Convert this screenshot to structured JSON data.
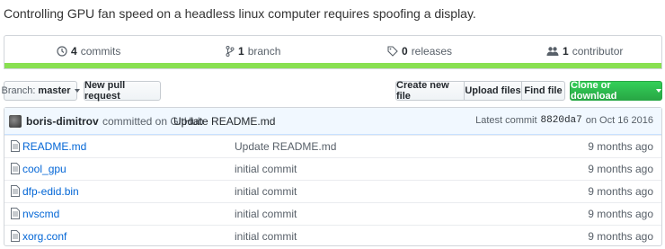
{
  "repo": {
    "description": "Controlling GPU fan speed on a headless linux computer requires spoofing a display."
  },
  "stats": {
    "commits": {
      "num": "4",
      "label": "commits",
      "icon": "history-icon"
    },
    "branches": {
      "num": "1",
      "label": "branch",
      "icon": "branch-icon"
    },
    "releases": {
      "num": "0",
      "label": "releases",
      "icon": "tag-icon"
    },
    "contributors": {
      "num": "1",
      "label": "contributor",
      "icon": "people-icon"
    }
  },
  "language_color": "#89e051",
  "toolbar": {
    "branch_prefix": "Branch:",
    "branch_name": "master",
    "new_pr": "New pull request",
    "create_file": "Create new file",
    "upload_files": "Upload files",
    "find_file": "Find file",
    "clone": "Clone or download"
  },
  "latest_commit": {
    "author": "boris-dimitrov",
    "verb": "committed on GitHub",
    "message": "Update README.md",
    "prefix": "Latest commit",
    "sha": "8820da7",
    "date": "on Oct 16 2016"
  },
  "files": [
    {
      "name": "README.md",
      "message": "Update README.md",
      "age": "9 months ago"
    },
    {
      "name": "cool_gpu",
      "message": "initial commit",
      "age": "9 months ago"
    },
    {
      "name": "dfp-edid.bin",
      "message": "initial commit",
      "age": "9 months ago"
    },
    {
      "name": "nvscmd",
      "message": "initial commit",
      "age": "9 months ago"
    },
    {
      "name": "xorg.conf",
      "message": "initial commit",
      "age": "9 months ago"
    }
  ]
}
